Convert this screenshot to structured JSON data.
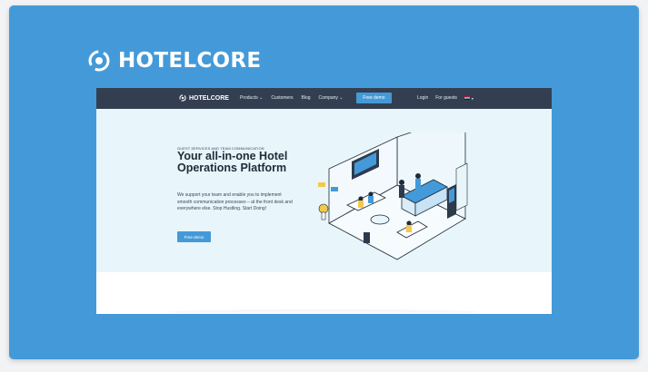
{
  "brand": {
    "name": "HOTELCORE",
    "logo_icon": "hotelcore-logo-icon"
  },
  "nav": {
    "logo": "HOTELCORE",
    "links": [
      "Products ⌄",
      "Customers",
      "Blog",
      "Company ⌄"
    ],
    "cta": "Free demo",
    "right": [
      "Login",
      "For guests"
    ],
    "language_icon": "uk-flag-icon"
  },
  "hero": {
    "eyebrow": "GUEST SERVICES AND TEAM COMMUNICATION",
    "headline": "Your all-in-one Hotel Operations Platform",
    "body": "We support your team and enable you to implement smooth communication processes – at the front desk and everywhere else. Stop Hustling. Start Doing!",
    "cta": "Free demo"
  },
  "colors": {
    "frame": "#449ad9",
    "nav_bg": "#333f51",
    "hero_bg": "#e8f5fb",
    "accent": "#449ad9"
  }
}
